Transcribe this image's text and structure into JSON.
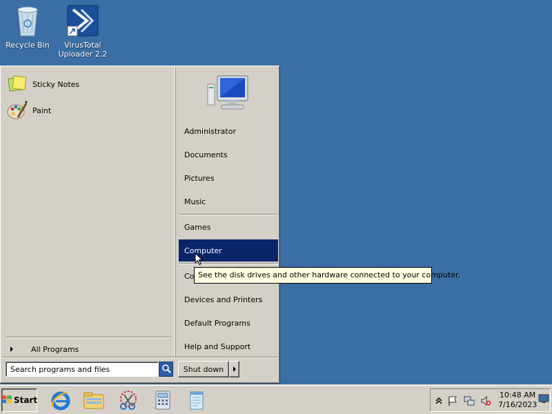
{
  "desktop": {
    "icons": [
      {
        "label": "Recycle Bin",
        "icon": "recycle-bin-icon"
      },
      {
        "label": "VirusTotal\nUploader 2.2",
        "icon": "virustotal-uploader-icon"
      }
    ],
    "background_color": "#3a6ea5"
  },
  "start_menu": {
    "pinned": [
      {
        "label": "Sticky Notes",
        "icon": "sticky-notes-icon"
      },
      {
        "label": "Paint",
        "icon": "paint-icon"
      }
    ],
    "all_programs_label": "All Programs",
    "search": {
      "placeholder": "Search programs and files"
    },
    "right_items": [
      {
        "label": "Administrator"
      },
      {
        "label": "Documents"
      },
      {
        "label": "Pictures"
      },
      {
        "label": "Music"
      },
      {
        "label": "Games"
      },
      {
        "label": "Computer",
        "selected": true
      },
      {
        "label": "Co"
      },
      {
        "label": "Devices and Printers"
      },
      {
        "label": "Default Programs"
      },
      {
        "label": "Help and Support"
      }
    ],
    "shutdown_label": "Shut down",
    "selection_color": "#0a246a"
  },
  "tooltip": {
    "text": "See the disk drives and other hardware connected to your computer."
  },
  "taskbar": {
    "start_label": "Start",
    "quick_launch": [
      "internet-explorer-icon",
      "windows-explorer-icon",
      "snipping-tool-icon",
      "calculator-icon",
      "notepad-icon"
    ],
    "tray": {
      "time": "10:48 AM",
      "date": "7/16/2023",
      "icons": [
        "show-hidden-icons-icon",
        "action-center-flag-icon",
        "network-icon",
        "volume-muted-icon",
        "show-desktop-icon"
      ]
    }
  }
}
